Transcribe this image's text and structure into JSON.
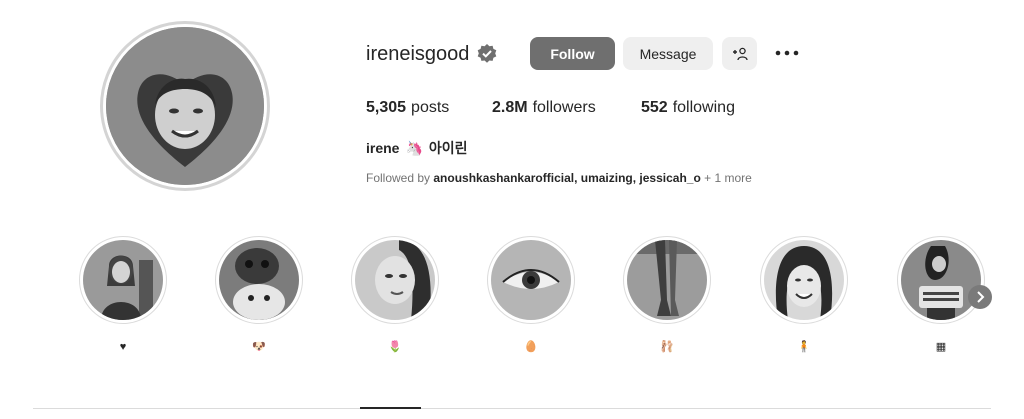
{
  "profile": {
    "username": "ireneisgood",
    "verified_icon": "verified-badge-icon",
    "full_name": "irene",
    "name_emoji": "🦄",
    "name_korean": "아이린"
  },
  "actions": {
    "follow_label": "Follow",
    "message_label": "Message",
    "add_user_icon": "+⁠☺",
    "more_icon": "more-options-icon"
  },
  "stats": {
    "posts_count": "5,305",
    "posts_label": "posts",
    "followers_count": "2.8M",
    "followers_label": "followers",
    "following_count": "552",
    "following_label": "following"
  },
  "followed_by": {
    "prefix": "Followed by",
    "users": "anoushkashankarofficial, umaizing, jessicah_o",
    "more": "+ 1 more"
  },
  "highlights": [
    {
      "label": "♥"
    },
    {
      "label": "🐶"
    },
    {
      "label": "🌷"
    },
    {
      "label": "🥚"
    },
    {
      "label": "🩰"
    },
    {
      "label": "🧍"
    },
    {
      "label": "▦"
    }
  ],
  "colors": {
    "follow_button": "#6f6f6f",
    "secondary_button": "#efefef",
    "text": "#262626",
    "muted_text": "#737373"
  }
}
